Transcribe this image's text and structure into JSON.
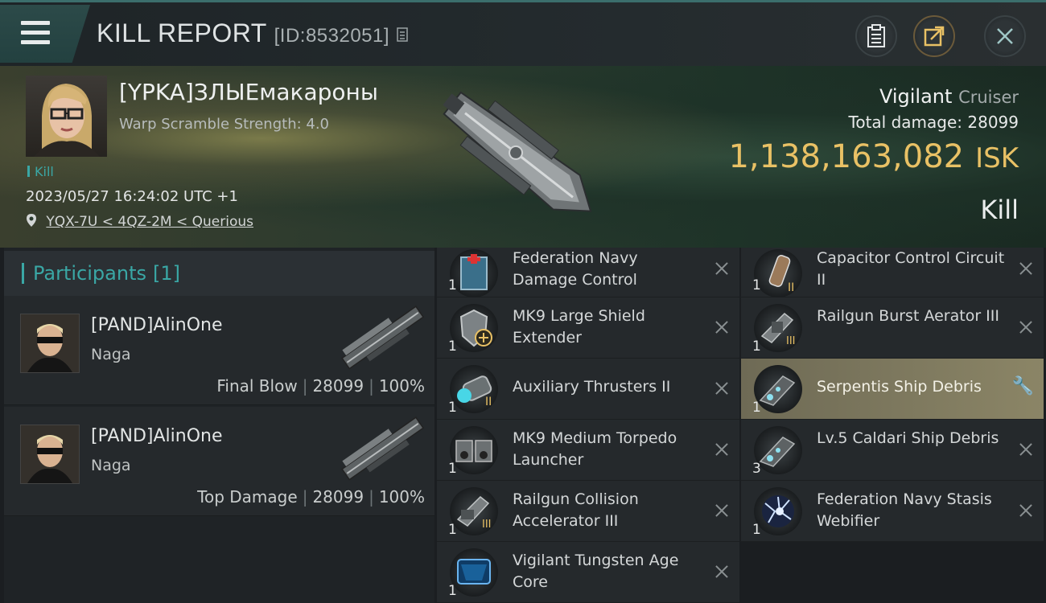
{
  "header": {
    "title": "KILL REPORT",
    "report_id": "[ID:8532051]"
  },
  "victim": {
    "pilot_name": "[YPKA]ЗЛЫЕмакароны",
    "warp_scramble": "Warp Scramble Strength: 4.0",
    "tag": "Kill",
    "datetime": "2023/05/27 16:24:02 UTC +1",
    "location": "YQX-7U < 4QZ-2M < Querious",
    "ship_name": "Vigilant",
    "ship_class": "Cruiser",
    "total_damage_label": "Total damage:",
    "total_damage": "28099",
    "isk_value": "1,138,163,082",
    "isk_label": "ISK",
    "result": "Kill"
  },
  "participants": {
    "header_label": "Participants",
    "count": "[1]",
    "list": [
      {
        "name": "[PAND]AlinOne",
        "ship": "Naga",
        "role": "Final Blow",
        "damage": "28099",
        "percent": "100%"
      },
      {
        "name": "[PAND]AlinOne",
        "ship": "Naga",
        "role": "Top Damage",
        "damage": "28099",
        "percent": "100%"
      }
    ]
  },
  "items_col1": [
    {
      "name": "Federation Navy Damage Control",
      "qty": "1"
    },
    {
      "name": "MK9 Large Shield Extender",
      "qty": "1"
    },
    {
      "name": "Auxiliary Thrusters II",
      "qty": "1"
    },
    {
      "name": "MK9 Medium Torpedo Launcher",
      "qty": "1"
    },
    {
      "name": "Railgun Collision Accelerator III",
      "qty": "1"
    },
    {
      "name": "Vigilant Tungsten Age Core",
      "qty": "1"
    }
  ],
  "items_col2": [
    {
      "name": "Capacitor Control Circuit II",
      "qty": "1"
    },
    {
      "name": "Railgun Burst Aerator III",
      "qty": "1"
    },
    {
      "name": "Serpentis Ship Debris",
      "qty": "1"
    },
    {
      "name": "Lv.5 Caldari Ship Debris",
      "qty": "3"
    },
    {
      "name": "Federation Navy Stasis Webifier",
      "qty": "1"
    }
  ],
  "colors": {
    "accent_teal": "#3aa7a5",
    "isk_gold": "#e9c165",
    "highlight_row": "#8b8566"
  }
}
